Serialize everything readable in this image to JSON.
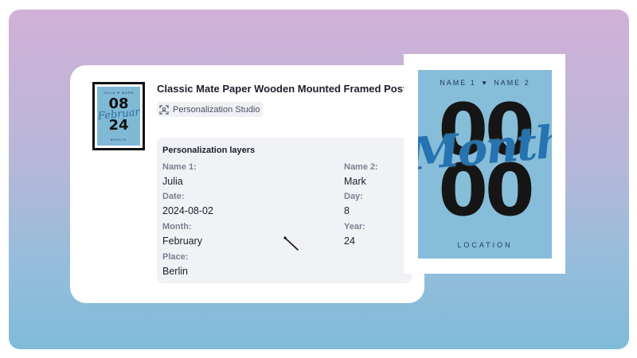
{
  "product": {
    "title": "Classic Mate Paper Wooden Mounted Framed Poster",
    "studio_label": "Personalization Studio"
  },
  "thumbnail": {
    "top_text": "JULIA ♥ MARK",
    "num_top": "08",
    "num_bottom": "24",
    "script": "February",
    "bottom_text": "BERLIN"
  },
  "layers": {
    "title": "Personalization layers",
    "fields": [
      {
        "label": "Name 1:",
        "value": "Julia"
      },
      {
        "label": "Name 2:",
        "value": "Mark"
      },
      {
        "label": "Date:",
        "value": "2024-08-02"
      },
      {
        "label": "Day:",
        "value": "8"
      },
      {
        "label": "Month:",
        "value": "February"
      },
      {
        "label": "Year:",
        "value": "24"
      },
      {
        "label": "Place:",
        "value": "Berlin"
      }
    ]
  },
  "poster": {
    "name1": "NAME 1",
    "name2": "NAME 2",
    "num_top": "00",
    "num_bottom": "00",
    "script": "Month",
    "location": "LOCATION"
  },
  "colors": {
    "poster_bg": "#86bdd9",
    "script_blue": "#2573b0"
  }
}
